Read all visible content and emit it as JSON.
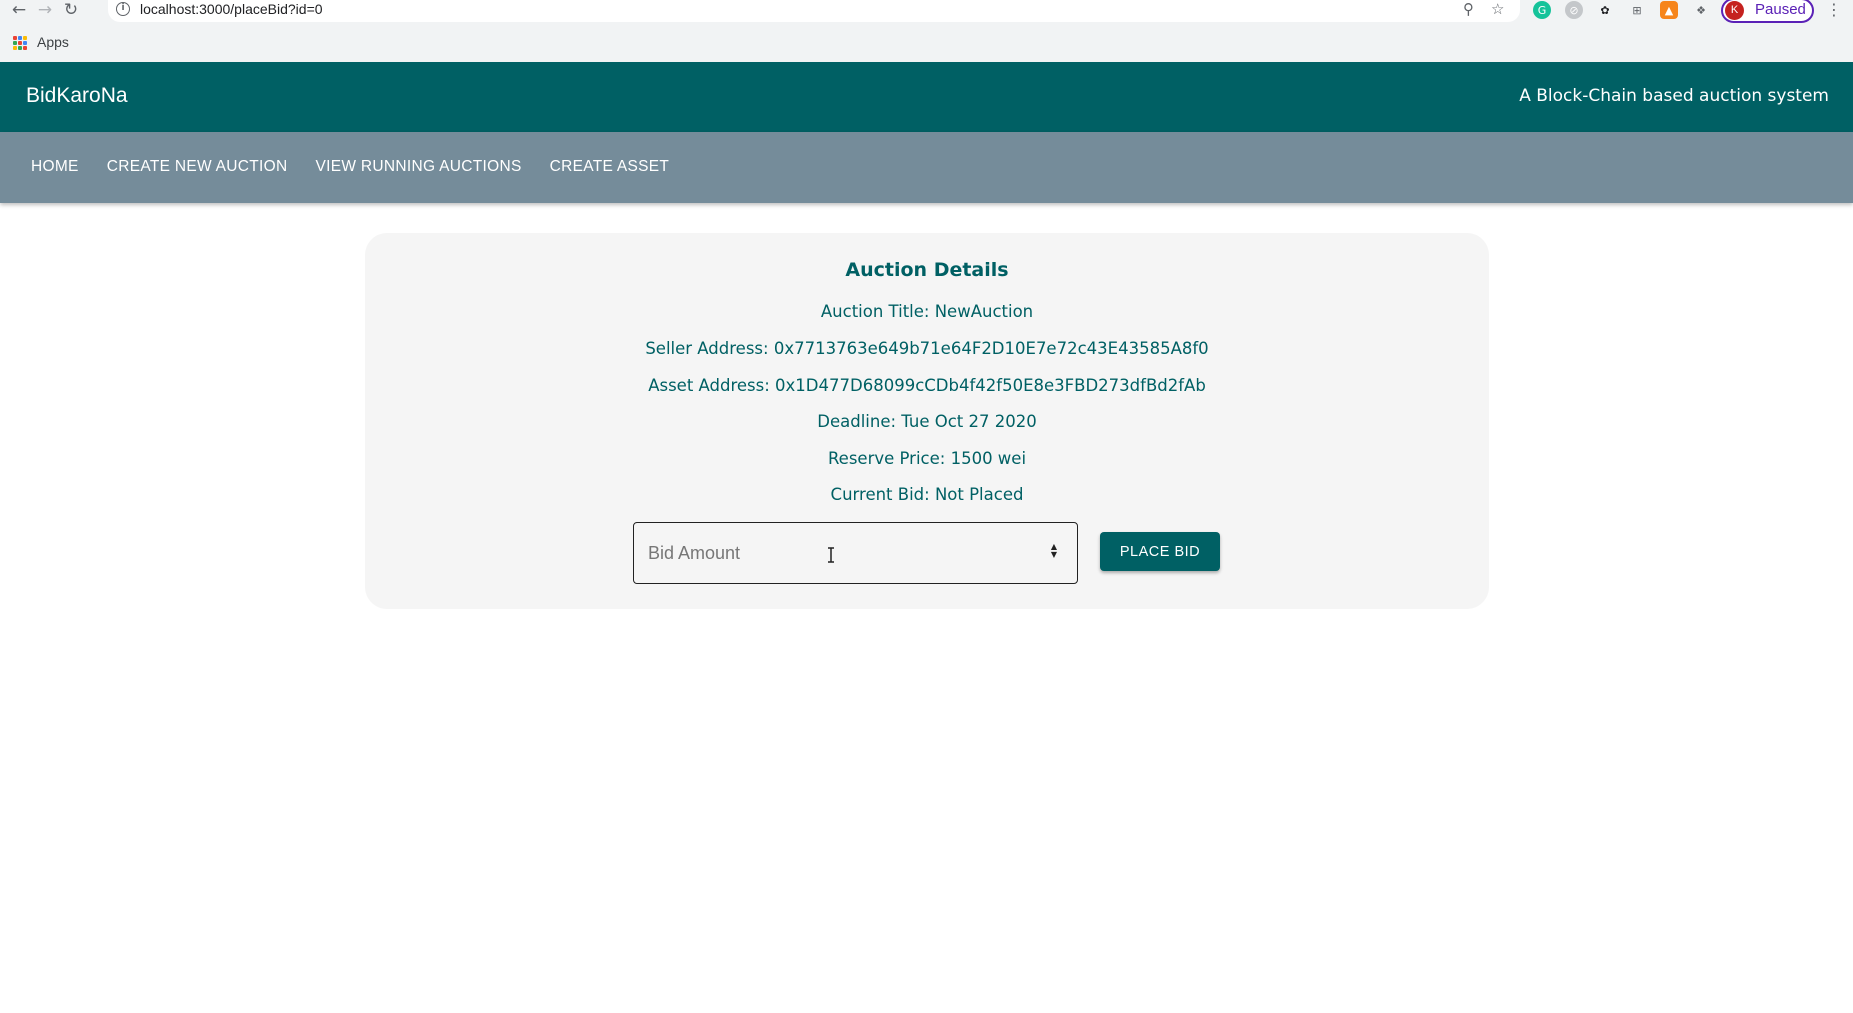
{
  "browser": {
    "url": "localhost:3000/placeBid?id=0",
    "profile_initial": "K",
    "profile_status": "Paused",
    "bookmarks_apps_label": "Apps"
  },
  "header": {
    "brand": "BidKaroNa",
    "tagline": "A Block-Chain based auction system"
  },
  "nav": {
    "items": [
      {
        "label": "HOME"
      },
      {
        "label": "CREATE NEW AUCTION"
      },
      {
        "label": "VIEW RUNNING AUCTIONS"
      },
      {
        "label": "CREATE ASSET"
      }
    ]
  },
  "auction": {
    "heading": "Auction Details",
    "title_line": "Auction Title: NewAuction",
    "seller_line": "Seller Address: 0x7713763e649b71e64F2D10E7e72c43E43585A8f0",
    "asset_line": "Asset Address: 0x1D477D68099cCDb4f42f50E8e3FBD273dfBd2fAb",
    "deadline_line": "Deadline: Tue Oct 27 2020",
    "reserve_line": "Reserve Price: 1500 wei",
    "current_bid_line": "Current Bid: Not Placed"
  },
  "bid_form": {
    "placeholder": "Bid Amount",
    "value": "",
    "button_label": "PLACE BID"
  },
  "colors": {
    "primary": "#006064",
    "nav_bg": "#758c9a",
    "card_bg": "#f5f5f5"
  }
}
